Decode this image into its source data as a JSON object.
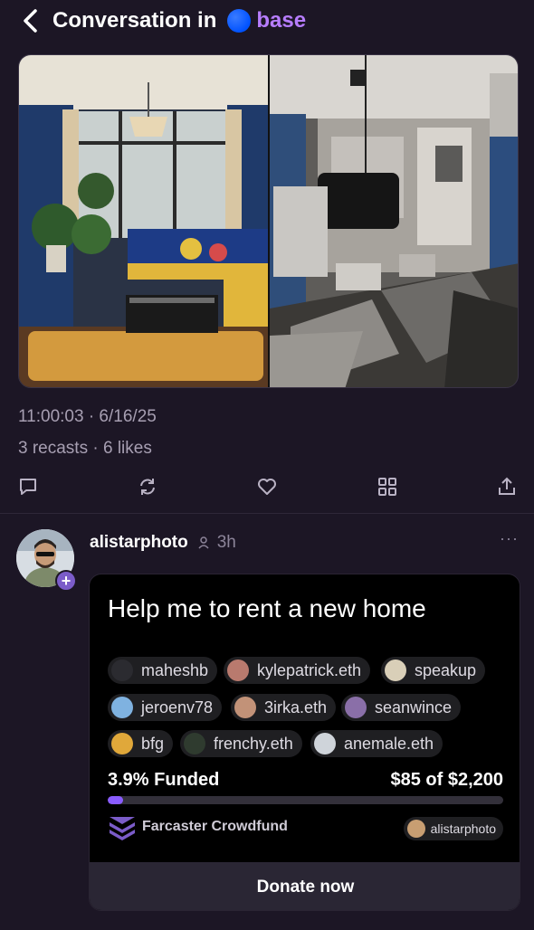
{
  "header": {
    "title": "Conversation in",
    "channel": "base",
    "back_icon": "chevron-left-icon"
  },
  "cast": {
    "timestamp": "11:00:03 · 6/16/25",
    "stats": "3 recasts · 6 likes",
    "images": [
      "living-room-before",
      "destroyed-room-after"
    ],
    "actions": [
      "reply-icon",
      "recast-icon",
      "like-icon",
      "grid-icon",
      "share-icon"
    ]
  },
  "reply": {
    "author": "alistarphoto",
    "time": "3h",
    "more": "···",
    "plus": "+"
  },
  "crowdfund": {
    "title": "Help me to rent a new home",
    "donors": [
      {
        "name": "maheshb",
        "color": "#2b2b30"
      },
      {
        "name": "kylepatrick.eth",
        "color": "#b97a6e"
      },
      {
        "name": "speakup",
        "color": "#d9cfb8"
      },
      {
        "name": "jeroenv78",
        "color": "#7fb2e0"
      },
      {
        "name": "3irka.eth",
        "color": "#c29278"
      },
      {
        "name": "seanwince",
        "color": "#8a6fa8"
      },
      {
        "name": "bfg",
        "color": "#e0a83a"
      },
      {
        "name": "frenchy.eth",
        "color": "#2f3b2f"
      },
      {
        "name": "anemale.eth",
        "color": "#cfd4da"
      }
    ],
    "funded_label": "3.9% Funded",
    "funded_fraction": 0.039,
    "amount_label": "$85 of $2,200",
    "platform": "Farcaster Crowdfund",
    "owner": "alistarphoto",
    "donate_label": "Donate now",
    "accent": "#8a5cff"
  }
}
